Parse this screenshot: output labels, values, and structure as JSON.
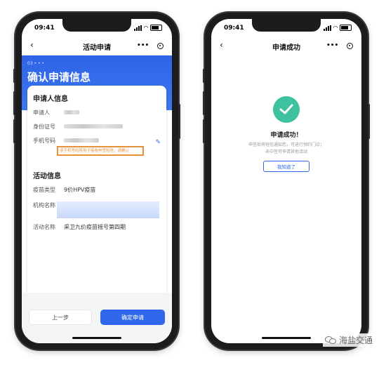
{
  "left_phone": {
    "status": {
      "time": "09:41"
    },
    "navbar": {
      "back": "‹",
      "title": "活动申请",
      "more": "•••"
    },
    "step_mark": "03 • • •",
    "page_title": "确认申请信息",
    "applicant": {
      "section_title": "申请人信息",
      "rows": [
        {
          "label": "申请人"
        },
        {
          "label": "身份证号"
        },
        {
          "label": "手机号码"
        }
      ],
      "phone_notice": "该手机号码将用于接收申签短信，请确认"
    },
    "activity": {
      "section_title": "活动信息",
      "rows": [
        {
          "label": "疫苗类型",
          "value": "9价HPV疫苗"
        },
        {
          "label": "机构名称",
          "value": ""
        },
        {
          "label": "活动名称",
          "value": "采卫九价疫苗摇号第四期"
        }
      ]
    },
    "buttons": {
      "prev": "上一步",
      "confirm": "确定申请"
    }
  },
  "right_phone": {
    "status": {
      "time": "09:41"
    },
    "navbar": {
      "back": "‹",
      "title": "申请成功",
      "more": "•••"
    },
    "success_title": "申请成功！",
    "success_desc_line1": "申签后将短信通知您，可进行预约门诊；",
    "success_desc_line2": "未中签可申请其他活动",
    "ok_button": "我知道了"
  },
  "watermark": {
    "text": "海盐交通",
    "icon": "wechat-icon"
  },
  "colors": {
    "primary_blue": "#2f68ea",
    "success_green": "#3fc1a0",
    "notice_orange": "#e8903a"
  }
}
